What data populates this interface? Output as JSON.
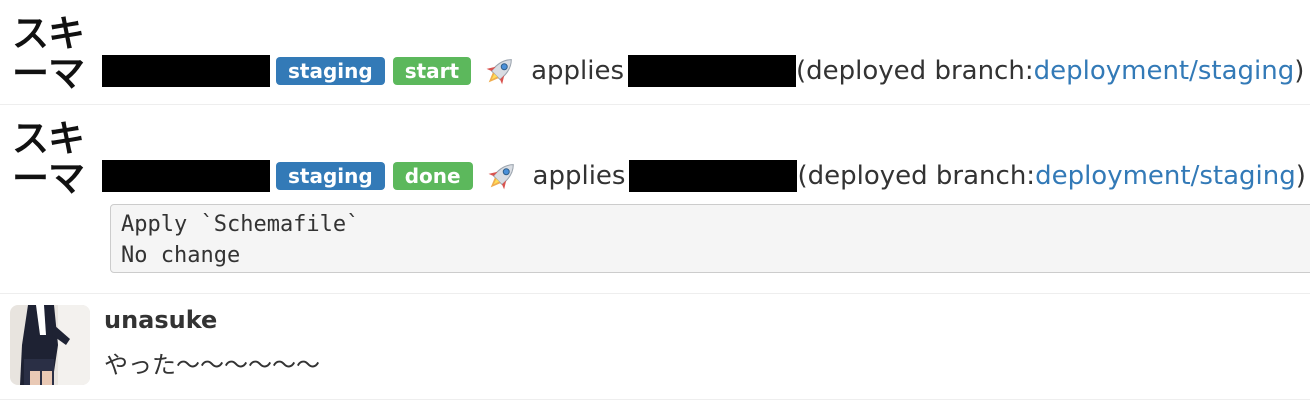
{
  "messages": [
    {
      "bot_icon_lines": [
        "スキ",
        "ーマ"
      ],
      "env_label": "staging",
      "status_label": "start",
      "status_color": "#5cb85c",
      "env_color": "#337ab7",
      "rocket_icon": "rocket-icon",
      "applies_text": "applies",
      "deployed_prefix": "(deployed branch: ",
      "branch_link": "deployment/staging",
      "deployed_suffix": ")"
    },
    {
      "bot_icon_lines": [
        "スキ",
        "ーマ"
      ],
      "env_label": "staging",
      "status_label": "done",
      "status_color": "#5cb85c",
      "env_color": "#337ab7",
      "rocket_icon": "rocket-icon",
      "applies_text": "applies",
      "deployed_prefix": "(deployed branch: ",
      "branch_link": "deployment/staging",
      "deployed_suffix": ")",
      "code_lines": [
        "Apply `Schemafile`",
        "No change"
      ]
    }
  ],
  "user_message": {
    "username": "unasuke",
    "text": "やった〜〜〜〜〜〜"
  }
}
